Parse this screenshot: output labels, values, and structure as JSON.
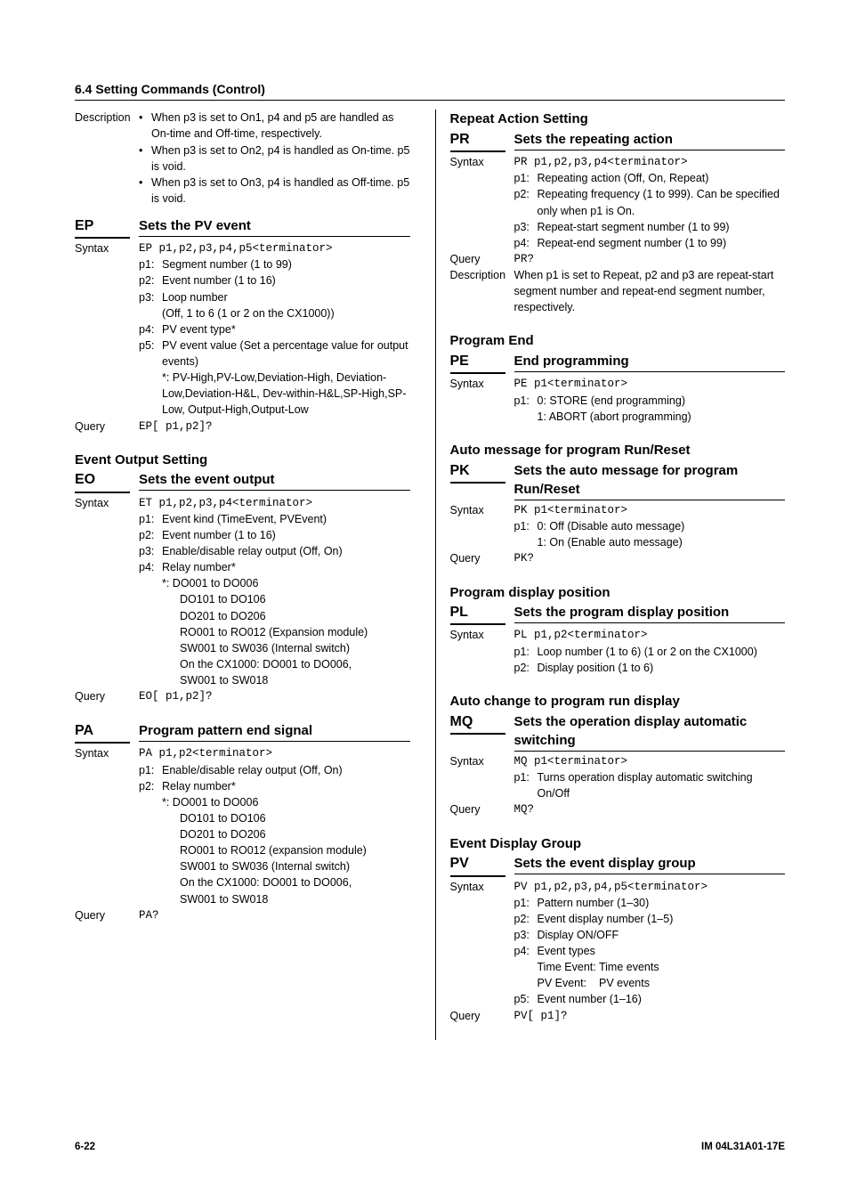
{
  "header": "6.4 Setting Commands (Control)",
  "left": {
    "descLabel": "Description",
    "descBullets": [
      "When p3 is set to On1, p4 and p5 are handled as On-time and Off-time, respectively.",
      "When p3 is set to On2, p4 is handled as On-time.  p5 is void.",
      "When p3 is set to On3, p4 is handled as Off-time.  p5 is void."
    ],
    "ep": {
      "code": "EP",
      "title": "Sets the PV event",
      "syntaxLabel": "Syntax",
      "syntax": "EP p1,p2,p3,p4,p5<terminator>",
      "p1": "Segment number (1 to 99)",
      "p2": "Event number (1 to 16)",
      "p3": "Loop number",
      "p3b": "(Off, 1 to 6 (1 or 2 on the CX1000))",
      "p4": "PV event type*",
      "p5": "PV event value (Set a percentage value for output events)",
      "star": "*: PV-High,PV-Low,Deviation-High, Deviation-Low,Deviation-H&L, Dev-within-H&L,SP-High,SP-Low, Output-High,Output-Low",
      "queryLabel": "Query",
      "query": "EP[ p1,p2]?"
    },
    "eo": {
      "super": "Event Output Setting",
      "code": "EO",
      "title": "Sets the event output",
      "syntaxLabel": "Syntax",
      "syntax": "ET p1,p2,p3,p4<terminator>",
      "p1": "Event kind (TimeEvent, PVEvent)",
      "p2": "Event number (1 to 16)",
      "p3": "Enable/disable relay output (Off, On)",
      "p4": "Relay number*",
      "star": "*: DO001 to DO006",
      "starLines": [
        "DO101 to DO106",
        "DO201 to DO206",
        "RO001 to RO012 (Expansion module)",
        "SW001 to SW036 (Internal switch)",
        "On the CX1000: DO001 to DO006,",
        "SW001 to SW018"
      ],
      "queryLabel": "Query",
      "query": "EO[ p1,p2]?"
    },
    "pa": {
      "code": "PA",
      "title": "Program pattern end signal",
      "syntaxLabel": "Syntax",
      "syntax": "PA p1,p2<terminator>",
      "p1": "Enable/disable relay output (Off, On)",
      "p2": "Relay number*",
      "star": "*: DO001 to DO006",
      "starLines": [
        "DO101 to DO106",
        "DO201 to DO206",
        "RO001 to RO012 (expansion module)",
        "SW001 to SW036 (Internal switch)",
        "On the CX1000: DO001 to DO006,",
        "SW001 to SW018"
      ],
      "queryLabel": "Query",
      "query": "PA?"
    }
  },
  "right": {
    "pr": {
      "super": "Repeat Action Setting",
      "code": "PR",
      "title": "Sets the repeating action",
      "syntaxLabel": "Syntax",
      "syntax": "PR p1,p2,p3,p4<terminator>",
      "p1": "Repeating action (Off, On, Repeat)",
      "p2": "Repeating frequency (1 to 999).  Can be specified only when p1 is On.",
      "p3": "Repeat-start segment number (1 to 99)",
      "p4": "Repeat-end segment number (1 to 99)",
      "queryLabel": "Query",
      "query": "PR?",
      "descLabel": "Description",
      "desc": "When p1 is set to Repeat, p2 and p3 are repeat-start segment number and repeat-end segment number, respectively."
    },
    "pe": {
      "super": "Program End",
      "code": "PE",
      "title": "End programming",
      "syntaxLabel": "Syntax",
      "syntax": "PE p1<terminator>",
      "p1a": "0: STORE (end programming)",
      "p1b": "1: ABORT (abort programming)"
    },
    "pk": {
      "super": "Auto message for program Run/Reset",
      "code": "PK",
      "title": "Sets the auto message for program Run/Reset",
      "syntaxLabel": "Syntax",
      "syntax": "PK p1<terminator>",
      "p1a": "0: Off (Disable auto message)",
      "p1b": "1: On (Enable auto message)",
      "queryLabel": "Query",
      "query": "PK?"
    },
    "pl": {
      "super": "Program display position",
      "code": "PL",
      "title": "Sets the program display position",
      "syntaxLabel": "Syntax",
      "syntax": "PL p1,p2<terminator>",
      "p1": "Loop number (1 to 6) (1 or 2 on the CX1000)",
      "p2": "Display position (1 to 6)"
    },
    "mq": {
      "super": "Auto change to program run display",
      "code": "MQ",
      "title": "Sets the operation display automatic switching",
      "syntaxLabel": "Syntax",
      "syntax": "MQ p1<terminator>",
      "p1": "Turns operation display automatic switching On/Off",
      "queryLabel": "Query",
      "query": "MQ?"
    },
    "pv": {
      "super": "Event Display Group",
      "code": "PV",
      "title": "Sets the event display group",
      "syntaxLabel": "Syntax",
      "syntax": "PV p1,p2,p3,p4,p5<terminator>",
      "p1": "Pattern number (1–30)",
      "p2": "Event display number (1–5)",
      "p3": "Display ON/OFF",
      "p4": "Event types",
      "p4a": "Time Event: Time events",
      "p4b": "PV Event:    PV events",
      "p5": "Event number (1–16)",
      "queryLabel": "Query",
      "query": "PV[ p1]?"
    }
  },
  "footer": {
    "page": "6-22",
    "doc": "IM 04L31A01-17E"
  }
}
